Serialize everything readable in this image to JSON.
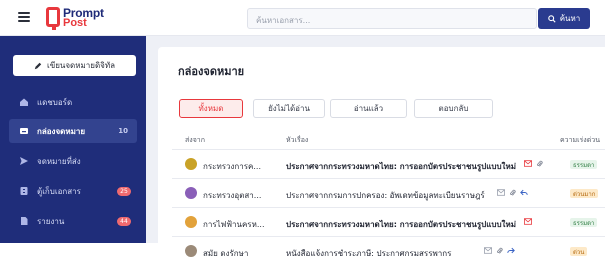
{
  "header": {
    "logo_line1": "Prompt",
    "logo_line2": "Post",
    "search_placeholder": "ค้นหาเอกสาร...",
    "search_button": "ค้นหา"
  },
  "sidebar": {
    "compose": "เขียนจดหมายดิจิทัล",
    "items": [
      {
        "label": "แดชบอร์ด",
        "icon": "dashboard-icon"
      },
      {
        "label": "กล่องจดหมาย",
        "icon": "inbox-icon",
        "count": "10",
        "active": true
      },
      {
        "label": "จดหมายที่ส่ง",
        "icon": "send-icon"
      },
      {
        "label": "ตู้เก็บเอกสาร",
        "icon": "cabinet-icon",
        "badge": "25"
      },
      {
        "label": "รายงาน",
        "icon": "report-icon",
        "badge": "44"
      }
    ]
  },
  "main": {
    "title": "กล่องจดหมาย",
    "filters": [
      "ทั้งหมด",
      "ยังไม่ได้อ่าน",
      "อ่านแล้ว",
      "ตอบกลับ"
    ],
    "columns": {
      "from": "ส่งจาก",
      "subject": "หัวเรื่อง",
      "priority": "ความเร่งด่วน"
    },
    "rows": [
      {
        "sender": "กระทรวงการค...",
        "subject": "ประกาศจากกระทรวงมหาดไทย: การออกบัตรประชาชนรูปแบบใหม่",
        "bold": true,
        "tag": "ธรรมดา",
        "tag_type": "normal"
      },
      {
        "sender": "กระทรวงอุตสา...",
        "subject": "ประกาศจากกรมการปกครอง: อัพเดทข้อมูลทะเบียนราษฎร์",
        "bold": false,
        "tag": "ด่วนมาก",
        "tag_type": "urgent"
      },
      {
        "sender": "การไฟฟ้านครห...",
        "subject": "ประกาศจากกระทรวงมหาดไทย: การออกบัตรประชาชนรูปแบบใหม่",
        "bold": true,
        "tag": "ธรรมดา",
        "tag_type": "normal"
      },
      {
        "sender": "สมัย ดงรักษา",
        "subject": "หนังสือแจ้งการชำระภาษี: ประกาศกรมสรรพากร",
        "bold": false,
        "tag": "ด่วน",
        "tag_type": "urgent"
      }
    ]
  },
  "colors": {
    "sidebar": "#1f2d7a",
    "accent": "#e8383d",
    "button": "#2a3b8f"
  }
}
